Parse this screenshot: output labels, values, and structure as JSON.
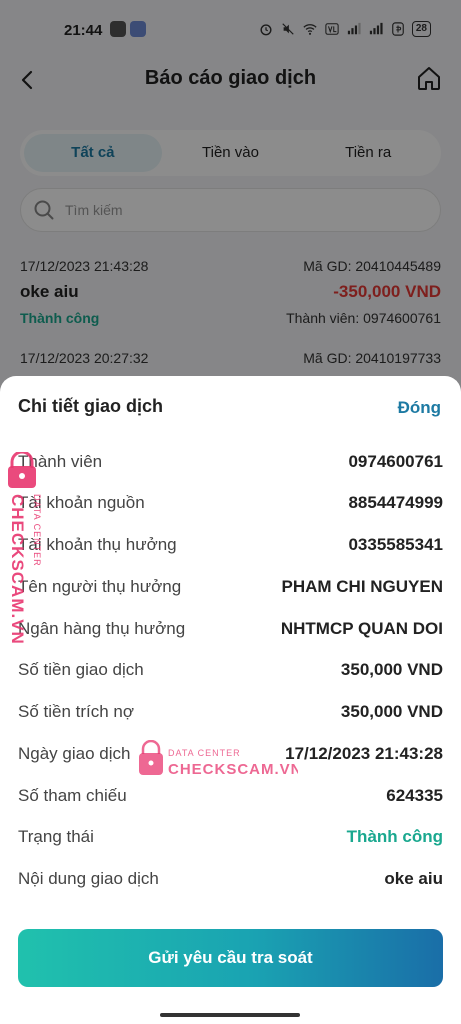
{
  "status_bar": {
    "time": "21:44",
    "battery": "28"
  },
  "header": {
    "title": "Báo cáo giao dịch"
  },
  "tabs": [
    {
      "label": "Tất cả",
      "active": true
    },
    {
      "label": "Tiền vào",
      "active": false
    },
    {
      "label": "Tiền ra",
      "active": false
    }
  ],
  "search": {
    "placeholder": "Tìm kiếm"
  },
  "transactions": [
    {
      "datetime": "17/12/2023 21:43:28",
      "code": "Mã GD: 20410445489",
      "name": "oke aiu",
      "amount": "-350,000 VND",
      "status": "Thành công",
      "member": "Thành viên: 0974600761"
    },
    {
      "datetime": "17/12/2023 20:27:32",
      "code": "Mã GD: 20410197733"
    }
  ],
  "sheet": {
    "title": "Chi tiết giao dịch",
    "close_label": "Đóng",
    "rows": [
      {
        "label": "Thành viên",
        "value": "0974600761"
      },
      {
        "label": "Tài khoản nguồn",
        "value": "8854474999"
      },
      {
        "label": "Tài khoản thụ hưởng",
        "value": "0335585341"
      },
      {
        "label": "Tên người thụ hưởng",
        "value": "PHAM CHI NGUYEN"
      },
      {
        "label": "Ngân hàng thụ hưởng",
        "value": "NHTMCP QUAN DOI"
      },
      {
        "label": "Số tiền giao dịch",
        "value": "350,000 VND"
      },
      {
        "label": "Số tiền trích nợ",
        "value": "350,000 VND"
      },
      {
        "label": "Ngày giao dịch",
        "value": "17/12/2023 21:43:28"
      },
      {
        "label": "Số tham chiếu",
        "value": "624335"
      },
      {
        "label": "Trạng thái",
        "value": "Thành công"
      },
      {
        "label": "Nội dung giao dịch",
        "value": "oke aiu"
      }
    ],
    "submit_label": "Gửi yêu cầu tra soát"
  },
  "watermark": {
    "line1": "DATA CENTER",
    "line2": "CHECKSCAM.VN"
  },
  "colors": {
    "accent": "#1d7aa3",
    "success": "#1aa88f",
    "negative": "#e53935",
    "watermark": "#e8366f"
  }
}
